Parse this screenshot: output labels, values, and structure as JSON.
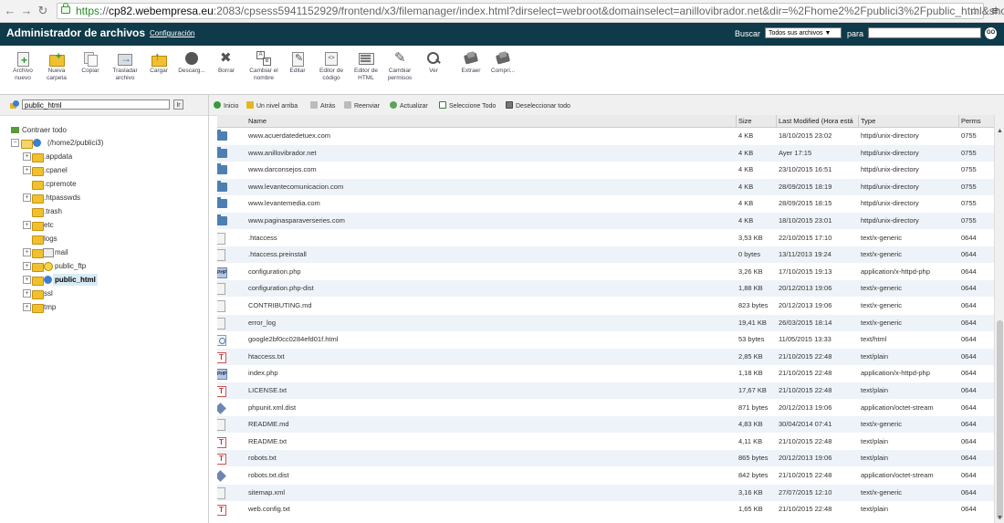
{
  "browser": {
    "url_scheme": "https",
    "url_host": "cp82.webempresa.eu",
    "url_rest": ":2083/cpsess5941152929/frontend/x3/filemanager/index.html?dirselect=webroot&domainselect=anillovibrador.net&dir=%2Fhome2%2Fpublici3%2Fpublic_html&showhid"
  },
  "header": {
    "title": "Administrador de archivos",
    "config_link": "Configuración",
    "search_label": "Buscar",
    "search_scope": "Todos sus archivos",
    "search_para": "para",
    "go_label": "GO"
  },
  "toolbar": [
    {
      "name": "new-file",
      "label": "Archivo nuevo",
      "icon": "new-file-icon"
    },
    {
      "name": "new-folder",
      "label": "Nueva carpeta",
      "icon": "new-folder-icon"
    },
    {
      "name": "copy",
      "label": "Copiar",
      "icon": "copy-icon"
    },
    {
      "name": "move",
      "label": "Trasladar archivo",
      "icon": "move-icon"
    },
    {
      "name": "upload",
      "label": "Cargar",
      "icon": "upload-icon"
    },
    {
      "name": "download",
      "label": "Descarg...",
      "icon": "download-icon"
    },
    {
      "name": "delete",
      "label": "Borrar",
      "icon": "delete-icon"
    },
    {
      "name": "rename",
      "label": "Cambiar el nombre",
      "icon": "rename-icon"
    },
    {
      "name": "edit",
      "label": "Editar",
      "icon": "edit-icon"
    },
    {
      "name": "code-editor",
      "label": "Editor de código",
      "icon": "code-editor-icon"
    },
    {
      "name": "html-editor",
      "label": "Editor de HTML",
      "icon": "html-editor-icon"
    },
    {
      "name": "permissions",
      "label": "Cambiar permisos",
      "icon": "permissions-icon"
    },
    {
      "name": "view",
      "label": "Ver",
      "icon": "view-icon"
    },
    {
      "name": "extract",
      "label": "Extraer",
      "icon": "extract-icon"
    },
    {
      "name": "compress",
      "label": "Compri...",
      "icon": "compress-icon"
    }
  ],
  "left": {
    "path_value": "public_html",
    "go_label": "Ir",
    "collapse_all": "Contraer todo",
    "tree": [
      {
        "label": "(/home2/publici3)",
        "level": 0,
        "icon": "root"
      },
      {
        "label": ".appdata",
        "level": 1,
        "icon": "folder"
      },
      {
        "label": ".cpanel",
        "level": 1,
        "icon": "folder"
      },
      {
        "label": ".cpremote",
        "level": 1,
        "icon": "folder"
      },
      {
        "label": ".htpasswds",
        "level": 1,
        "icon": "folder"
      },
      {
        "label": ".trash",
        "level": 1,
        "icon": "folder"
      },
      {
        "label": "etc",
        "level": 1,
        "icon": "folder"
      },
      {
        "label": "logs",
        "level": 1,
        "icon": "folder"
      },
      {
        "label": "mail",
        "level": 1,
        "icon": "mail"
      },
      {
        "label": "public_ftp",
        "level": 1,
        "icon": "ftp"
      },
      {
        "label": "public_html",
        "level": 1,
        "icon": "web",
        "selected": true
      },
      {
        "label": "ssl",
        "level": 1,
        "icon": "folder"
      },
      {
        "label": "tmp",
        "level": 1,
        "icon": "folder"
      }
    ]
  },
  "nav": {
    "home": "Inicio",
    "up": "Un nivel arriba",
    "back": "Atrás",
    "reload": "Reenviar",
    "refresh": "Actualizar",
    "select_all": "Seleccione Todo",
    "deselect_all": "Deseleccionar todo"
  },
  "table": {
    "headers": {
      "name": "Name",
      "size": "Size",
      "modified": "Last Modified (Hora está",
      "type": "Type",
      "perms": "Perms"
    },
    "rows": [
      {
        "icon": "dir",
        "name": "www.acuerdatedetuex.com",
        "size": "4 KB",
        "modified": "18/10/2015 23:02",
        "type": "httpd/unix-directory",
        "perms": "0755"
      },
      {
        "icon": "dir",
        "name": "www.anillovibrador.net",
        "size": "4 KB",
        "modified": "Ayer 17:15",
        "type": "httpd/unix-directory",
        "perms": "0755"
      },
      {
        "icon": "dir",
        "name": "www.darconsejos.com",
        "size": "4 KB",
        "modified": "23/10/2015 16:51",
        "type": "httpd/unix-directory",
        "perms": "0755"
      },
      {
        "icon": "dir",
        "name": "www.levantecomunicacion.com",
        "size": "4 KB",
        "modified": "28/09/2015 18:19",
        "type": "httpd/unix-directory",
        "perms": "0755"
      },
      {
        "icon": "dir",
        "name": "www.levantemedia.com",
        "size": "4 KB",
        "modified": "28/09/2015 18:15",
        "type": "httpd/unix-directory",
        "perms": "0755"
      },
      {
        "icon": "dir",
        "name": "www.paginasparaverseries.com",
        "size": "4 KB",
        "modified": "18/10/2015 23:01",
        "type": "httpd/unix-directory",
        "perms": "0755"
      },
      {
        "icon": "gen",
        "name": ".htaccess",
        "size": "3,53 KB",
        "modified": "22/10/2015 17:10",
        "type": "text/x-generic",
        "perms": "0644"
      },
      {
        "icon": "gen",
        "name": ".htaccess.preinstall",
        "size": "0 bytes",
        "modified": "13/11/2013 19:24",
        "type": "text/x-generic",
        "perms": "0644"
      },
      {
        "icon": "php",
        "name": "configuration.php",
        "size": "3,26 KB",
        "modified": "17/10/2015 19:13",
        "type": "application/x-httpd-php",
        "perms": "0644"
      },
      {
        "icon": "gen",
        "name": "configuration.php-dist",
        "size": "1,88 KB",
        "modified": "20/12/2013 19:06",
        "type": "text/x-generic",
        "perms": "0644"
      },
      {
        "icon": "gen",
        "name": "CONTRIBUTING.md",
        "size": "823 bytes",
        "modified": "20/12/2013 19:06",
        "type": "text/x-generic",
        "perms": "0644"
      },
      {
        "icon": "gen",
        "name": "error_log",
        "size": "19,41 KB",
        "modified": "26/03/2015 18:14",
        "type": "text/x-generic",
        "perms": "0644"
      },
      {
        "icon": "html",
        "name": "google2bf0cc0284efd01f.html",
        "size": "53 bytes",
        "modified": "11/05/2015 13:33",
        "type": "text/html",
        "perms": "0644"
      },
      {
        "icon": "txt",
        "name": "htaccess.txt",
        "size": "2,85 KB",
        "modified": "21/10/2015 22:48",
        "type": "text/plain",
        "perms": "0644"
      },
      {
        "icon": "php",
        "name": "index.php",
        "size": "1,18 KB",
        "modified": "21/10/2015 22:48",
        "type": "application/x-httpd-php",
        "perms": "0644"
      },
      {
        "icon": "txt",
        "name": "LICENSE.txt",
        "size": "17,67 KB",
        "modified": "21/10/2015 22:48",
        "type": "text/plain",
        "perms": "0644"
      },
      {
        "icon": "bin",
        "name": "phpunit.xml.dist",
        "size": "871 bytes",
        "modified": "20/12/2013 19:06",
        "type": "application/octet-stream",
        "perms": "0644"
      },
      {
        "icon": "gen",
        "name": "README.md",
        "size": "4,83 KB",
        "modified": "30/04/2014 07:41",
        "type": "text/x-generic",
        "perms": "0644"
      },
      {
        "icon": "txt",
        "name": "README.txt",
        "size": "4,11 KB",
        "modified": "21/10/2015 22:48",
        "type": "text/plain",
        "perms": "0644"
      },
      {
        "icon": "txt",
        "name": "robots.txt",
        "size": "865 bytes",
        "modified": "20/12/2013 19:06",
        "type": "text/plain",
        "perms": "0644"
      },
      {
        "icon": "bin",
        "name": "robots.txt.dist",
        "size": "842 bytes",
        "modified": "21/10/2015 22:48",
        "type": "application/octet-stream",
        "perms": "0644"
      },
      {
        "icon": "gen",
        "name": "sitemap.xml",
        "size": "3,16 KB",
        "modified": "27/07/2015 12:10",
        "type": "text/x-generic",
        "perms": "0644"
      },
      {
        "icon": "txt",
        "name": "web.config.txt",
        "size": "1,65 KB",
        "modified": "21/10/2015 22:48",
        "type": "text/plain",
        "perms": "0644"
      }
    ]
  }
}
